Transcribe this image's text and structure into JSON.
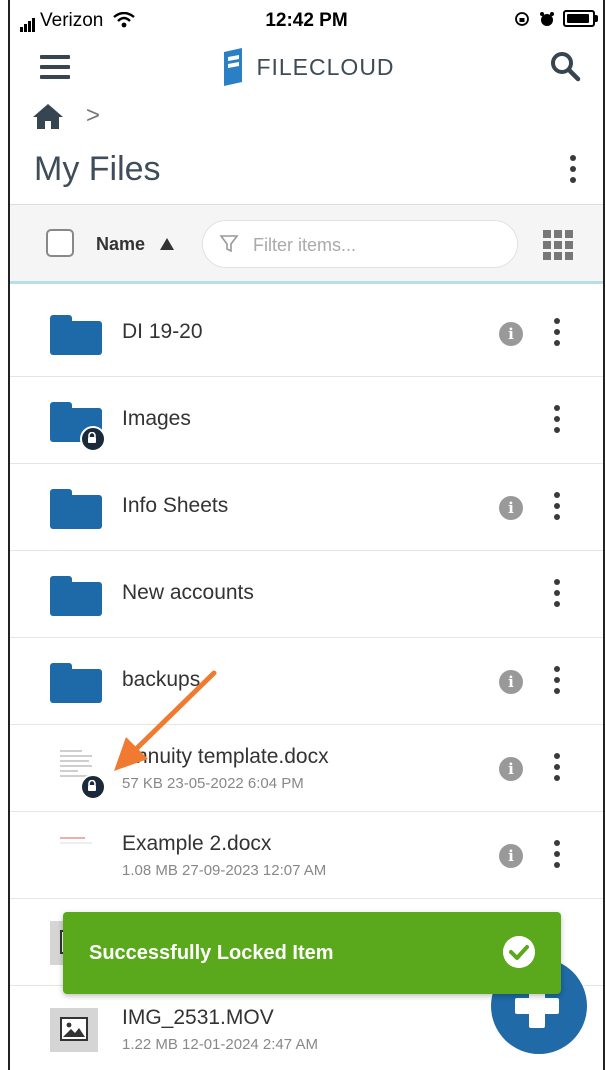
{
  "status_bar": {
    "carrier": "Verizon",
    "time": "12:42 PM"
  },
  "header": {
    "brand": "FILECLOUD"
  },
  "breadcrumb": {
    "separator": ">"
  },
  "page": {
    "title": "My Files"
  },
  "toolbar": {
    "sort_label": "Name",
    "filter_placeholder": "Filter items..."
  },
  "items": [
    {
      "name": "DI 19-20",
      "type": "folder",
      "locked": false,
      "has_info": true
    },
    {
      "name": "Images",
      "type": "folder",
      "locked": true,
      "has_info": false
    },
    {
      "name": "Info Sheets",
      "type": "folder",
      "locked": false,
      "has_info": true
    },
    {
      "name": "New accounts",
      "type": "folder",
      "locked": false,
      "has_info": false
    },
    {
      "name": "backups",
      "type": "folder",
      "locked": false,
      "has_info": true
    },
    {
      "name": "Annuity template.docx",
      "meta": "57 KB 23-05-2022 6:04 PM",
      "type": "document",
      "locked": true,
      "has_info": true
    },
    {
      "name": "Example 2.docx",
      "meta": "1.08 MB 27-09-2023 12:07 AM",
      "type": "document",
      "locked": false,
      "has_info": true
    },
    {
      "name": "",
      "type": "image",
      "locked": false,
      "has_info": false
    },
    {
      "name": "IMG_2531.MOV",
      "meta": "1.22 MB 12-01-2024 2:47 AM",
      "type": "image",
      "locked": false,
      "has_info": false
    }
  ],
  "toast": {
    "message": "Successfully Locked Item"
  },
  "colors": {
    "folder": "#1e6aa8",
    "toast": "#5aa81b",
    "fab": "#1f6aa7",
    "annotation_arrow": "#f07a2f"
  }
}
